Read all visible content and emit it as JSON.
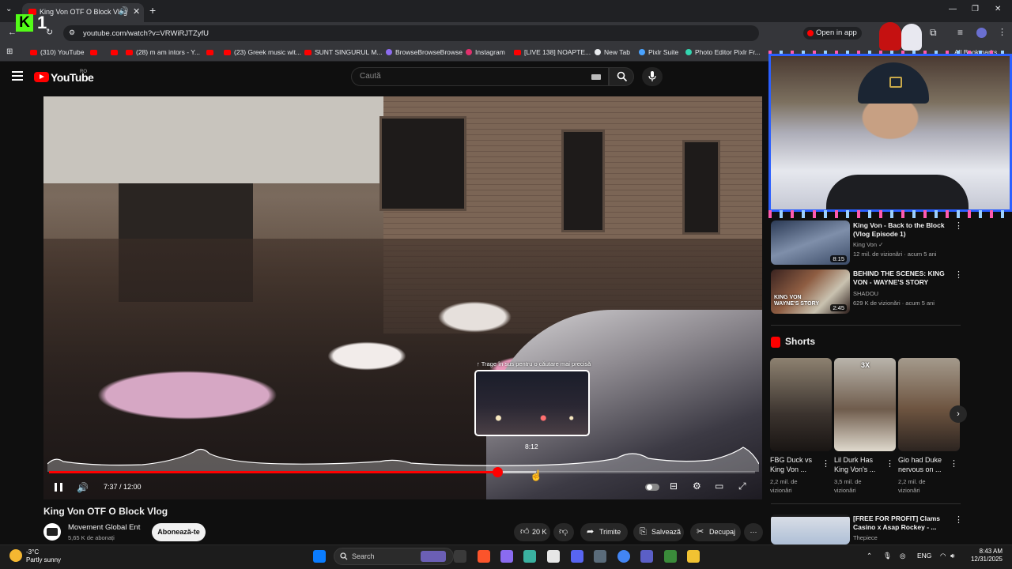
{
  "browser": {
    "tab_title": "King Von OTF O Block Vlog",
    "new_tab": "+",
    "url": "youtube.com/watch?v=VRWiRJTZyfU",
    "open_in_app": "Open in app",
    "all_bookmarks": "All Bookmarks",
    "bookmarks": [
      {
        "label": "(310) YouTube",
        "icon": "youtube-icon"
      },
      {
        "label": "",
        "icon": "youtube-icon"
      },
      {
        "label": "(28) m am intors - Y...",
        "icon": "youtube-icon"
      },
      {
        "label": "(23) Greek music wit...",
        "icon": "youtube-icon"
      },
      {
        "label": "SUNT SINGURUL M...",
        "icon": "youtube-icon"
      },
      {
        "label": "BrowseBrowseBrowse",
        "icon": "browse-icon"
      },
      {
        "label": "Instagram",
        "icon": "instagram-icon"
      },
      {
        "label": "[LIVE 138] NOAPTE...",
        "icon": "youtube-icon"
      },
      {
        "label": "New Tab",
        "icon": "globe-icon"
      },
      {
        "label": "Pixlr Suite",
        "icon": "pixlr-icon"
      },
      {
        "label": "Photo Editor Pixlr Fr...",
        "icon": "pixlr-icon"
      }
    ]
  },
  "overlay": {
    "logo_letter": "K",
    "counter": "1"
  },
  "youtube": {
    "logo_text": "YouTube",
    "region": "RO",
    "search_placeholder": "Caută"
  },
  "player": {
    "hover_hint": "↑ Trage în sus pentru o căutare mai precisă",
    "hover_time": "8:12",
    "time_display": "7:37 / 12:00",
    "played_fraction": 0.635,
    "buffered_fraction": 0.69
  },
  "video": {
    "title": "King Von OTF O Block Vlog",
    "channel": "Movement Global Ent",
    "subscribers": "5,65 K de abonați",
    "subscribe_label": "Abonează-te",
    "likes": "20 K",
    "share_label": "Trimite",
    "save_label": "Salvează",
    "clip_label": "Decupaj",
    "more": "⋯"
  },
  "recommended": [
    {
      "title": "King Von - Back to the Block (Vlog Episode 1)",
      "channel": "King Von",
      "meta": "12 mil. de vizionări · acum 5 ani",
      "duration": "8:15"
    },
    {
      "title": "BEHIND THE SCENES: KING VON - WAYNE'S STORY",
      "channel": "SHADOU",
      "meta": "629 K de vizionări · acum 5 ani",
      "duration": "2:45",
      "thumb_text": "KING VON WAYNE'S STORY"
    },
    {
      "title": "[FREE FOR PROFIT] Clams Casino x Asap Rockey - ...",
      "channel": "Thepiece",
      "meta": "",
      "duration": ""
    }
  ],
  "shorts": {
    "heading": "Shorts",
    "items": [
      {
        "title": "FBG Duck vs King Von ...",
        "views": "2,2 mil. de vizionări"
      },
      {
        "title": "Lil Durk Has King Von's ...",
        "views": "3,5 mil. de vizionări",
        "badge": "3X"
      },
      {
        "title": "Gio had Duke nervous on ...",
        "views": "2,2 mil. de vizionări"
      }
    ]
  },
  "taskbar": {
    "weather_temp": "-3°C",
    "weather_desc": "Partly sunny",
    "search_label": "Search",
    "lang": "ENG",
    "time": "8:43 AM",
    "date": "12/31/2025"
  },
  "colors": {
    "accent": "#ff0000",
    "bg": "#0f0f0f",
    "webcam_border": "#2b5fff",
    "kick": "#53fc18"
  }
}
